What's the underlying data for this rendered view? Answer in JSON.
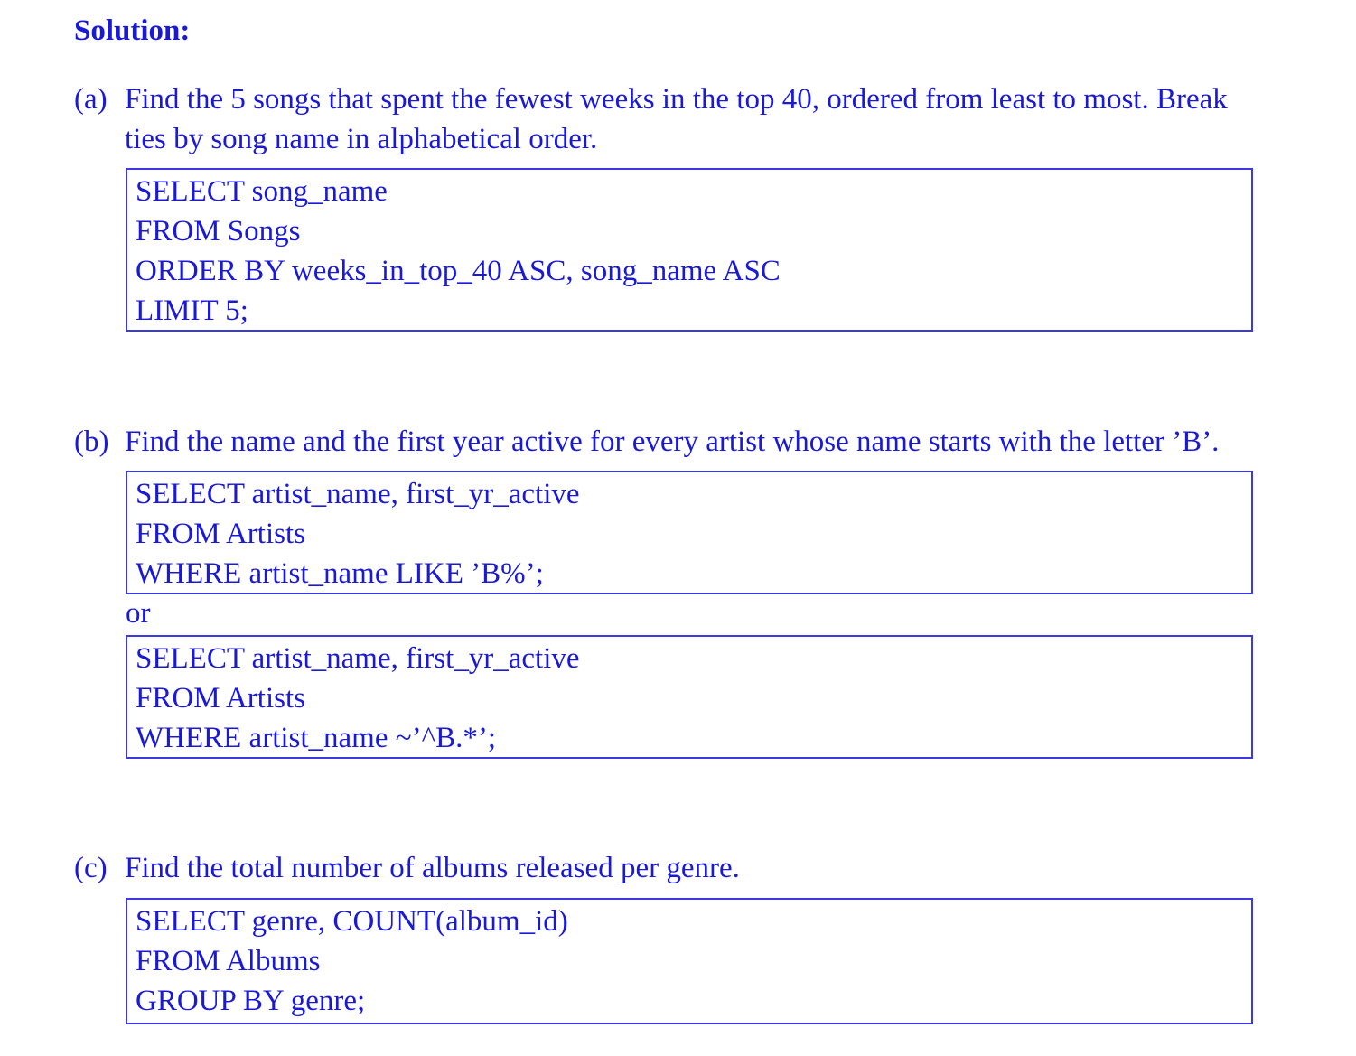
{
  "heading": "Solution:",
  "parts": {
    "a": {
      "label": "(a)",
      "line1": "Find the 5 songs that spent the fewest weeks in the top 40, ordered from least to most. Break",
      "line2": "ties by song name in alphabetical order.",
      "code": [
        "SELECT song_name",
        "FROM Songs",
        "ORDER BY weeks_in_top_40 ASC, song_name ASC",
        "LIMIT 5;"
      ]
    },
    "b": {
      "label": "(b)",
      "line1": "Find the name and the first year active for every artist whose name starts with the letter ’B’.",
      "code1": [
        "SELECT artist_name, first_yr_active",
        "FROM Artists",
        "WHERE artist_name LIKE ’B%’;"
      ],
      "or": "or",
      "code2": [
        "SELECT artist_name, first_yr_active",
        "FROM Artists",
        "WHERE artist_name ~’^B.*’;"
      ]
    },
    "c": {
      "label": "(c)",
      "line1": "Find the total number of albums released per genre.",
      "code": [
        "SELECT genre, COUNT(album_id)",
        "FROM Albums",
        "GROUP BY genre;"
      ]
    }
  },
  "colors": {
    "text": "#1a1ad6",
    "box_border": "#3a3ae0"
  }
}
